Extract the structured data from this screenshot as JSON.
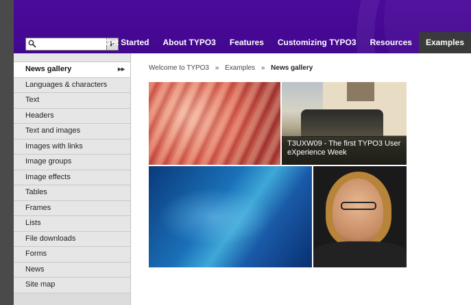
{
  "search": {
    "placeholder": "",
    "value": ""
  },
  "nav": {
    "items": [
      {
        "label": "Get Started",
        "active": false
      },
      {
        "label": "About TYPO3",
        "active": false
      },
      {
        "label": "Features",
        "active": false
      },
      {
        "label": "Customizing TYPO3",
        "active": false
      },
      {
        "label": "Resources",
        "active": false
      },
      {
        "label": "Examples",
        "active": true
      }
    ]
  },
  "sidebar": {
    "items": [
      {
        "label": "News gallery",
        "active": true,
        "arrow": "▸▸"
      },
      {
        "label": "Languages & characters"
      },
      {
        "label": "Text"
      },
      {
        "label": "Headers"
      },
      {
        "label": "Text and images"
      },
      {
        "label": "Images with links"
      },
      {
        "label": "Image groups"
      },
      {
        "label": "Image effects"
      },
      {
        "label": "Tables"
      },
      {
        "label": "Frames"
      },
      {
        "label": "Lists"
      },
      {
        "label": "File downloads"
      },
      {
        "label": "Forms"
      },
      {
        "label": "News"
      },
      {
        "label": "Site map"
      }
    ]
  },
  "breadcrumb": {
    "items": [
      "Welcome to TYPO3",
      "Examples",
      "News gallery"
    ],
    "separator": "»"
  },
  "gallery": {
    "caption": "T3UXW09 - The first TYPO3 User eXperience Week"
  },
  "colors": {
    "header_purple": "#4c0a9a",
    "active_nav": "#3a3a3a",
    "sidebar_bg": "#e6e6e6"
  }
}
